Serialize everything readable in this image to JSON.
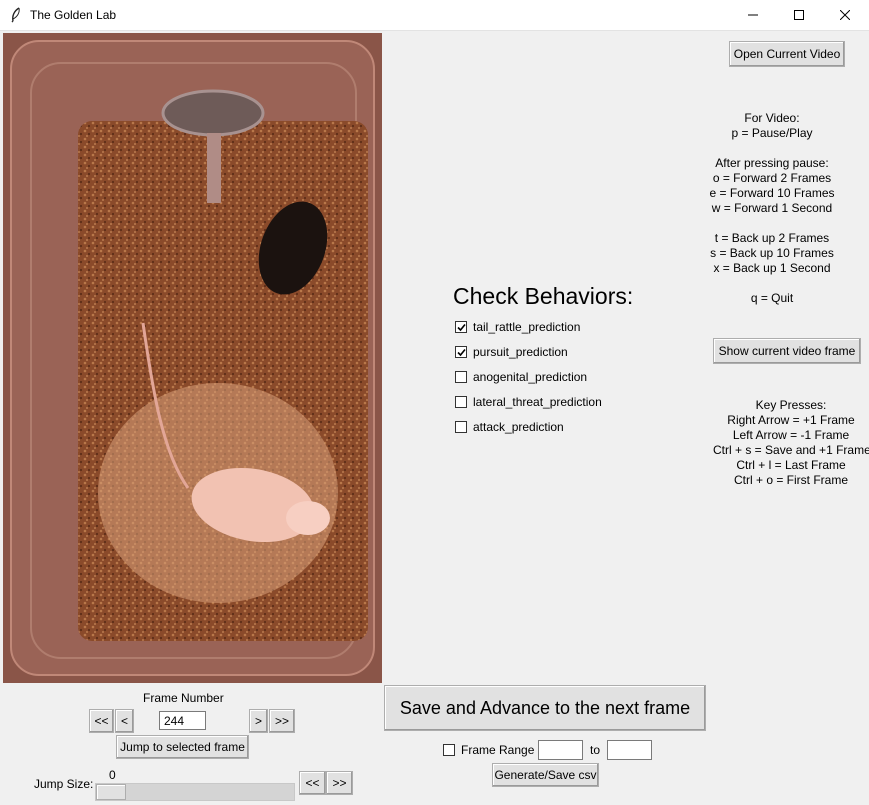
{
  "window": {
    "title": "The Golden Lab"
  },
  "frame_nav": {
    "label": "Frame Number",
    "first_label": "<<",
    "prev_label": "<",
    "frame_value": "244",
    "next_label": ">",
    "last_label": ">>",
    "jump_button": "Jump to selected frame"
  },
  "jump": {
    "label": "Jump Size:",
    "value": "0",
    "back_label": "<<",
    "fwd_label": ">>"
  },
  "video_controls": {
    "open_button": "Open Current Video",
    "show_frame_button": "Show current video frame",
    "help_video": "For Video:\np = Pause/Play\n\nAfter pressing pause:\no = Forward 2 Frames\ne = Forward 10 Frames\nw = Forward 1 Second\n\nt = Back up 2 Frames\ns = Back up 10 Frames\nx = Back up 1 Second\n\nq = Quit",
    "help_keys": "Key Presses:\nRight Arrow = +1 Frame\nLeft Arrow = -1 Frame\nCtrl + s = Save and +1 Frame\nCtrl + l = Last Frame\nCtrl + o = First Frame"
  },
  "behaviors": {
    "heading": "Check Behaviors:",
    "items": [
      {
        "label": "tail_rattle_prediction",
        "checked": true
      },
      {
        "label": "pursuit_prediction",
        "checked": true
      },
      {
        "label": "anogenital_prediction",
        "checked": false
      },
      {
        "label": "lateral_threat_prediction",
        "checked": false
      },
      {
        "label": "attack_prediction",
        "checked": false
      }
    ]
  },
  "save": {
    "button": "Save and Advance to the next frame",
    "range_label": "Frame Range",
    "range_checked": false,
    "from_value": "",
    "to_label": "to",
    "to_value": "",
    "generate_button": "Generate/Save csv"
  }
}
